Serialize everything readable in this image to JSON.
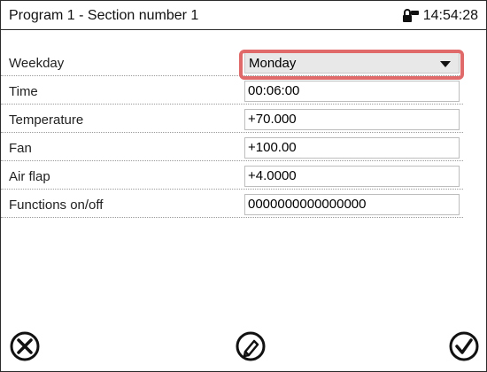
{
  "header": {
    "title": "Program 1 - Section number 1",
    "time": "14:54:28"
  },
  "fields": [
    {
      "label": "Weekday",
      "value": "Monday",
      "type": "select"
    },
    {
      "label": "Time",
      "value": "00:06:00",
      "type": "input"
    },
    {
      "label": "Temperature",
      "value": "+70.000",
      "type": "input"
    },
    {
      "label": "Fan",
      "value": "+100.00",
      "type": "input"
    },
    {
      "label": "Air flap",
      "value": "+4.0000",
      "type": "input"
    },
    {
      "label": "Functions on/off",
      "value": "0000000000000000",
      "type": "input"
    }
  ],
  "icons": {
    "close": "close-circle-icon",
    "edit": "pencil-circle-icon",
    "confirm": "checkmark-circle-icon",
    "lock": "lock-icon"
  },
  "colors": {
    "highlight": "#e06a6a",
    "select_bg": "#e8e8e8"
  }
}
